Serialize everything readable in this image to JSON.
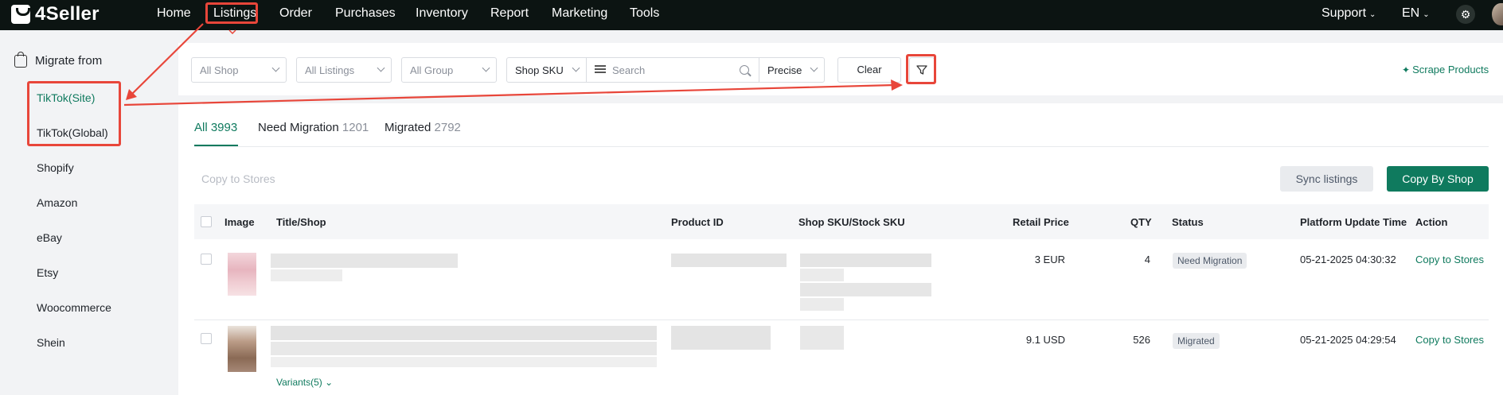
{
  "brand": {
    "name": "4Seller"
  },
  "nav": {
    "items": [
      "Home",
      "Listings",
      "Order",
      "Purchases",
      "Inventory",
      "Report",
      "Marketing",
      "Tools"
    ],
    "support": "Support",
    "language": "EN"
  },
  "sidebar": {
    "heading": "Migrate from",
    "items": [
      "TikTok(Site)",
      "TikTok(Global)",
      "Shopify",
      "Amazon",
      "eBay",
      "Etsy",
      "Woocommerce",
      "Shein"
    ]
  },
  "filters": {
    "shop": "All Shop",
    "listings": "All Listings",
    "group": "All Group",
    "sku_type": "Shop SKU",
    "search_placeholder": "Search",
    "match_mode": "Precise",
    "clear": "Clear",
    "scrape": "Scrape Products"
  },
  "tabs": [
    {
      "label": "All",
      "count": "3993"
    },
    {
      "label": "Need Migration",
      "count": "1201"
    },
    {
      "label": "Migrated",
      "count": "2792"
    }
  ],
  "actions": {
    "copy_to_stores": "Copy to Stores",
    "sync": "Sync listings",
    "copy_by_shop": "Copy By Shop"
  },
  "table": {
    "columns": [
      "Image",
      "Title/Shop",
      "Product ID",
      "Shop SKU/Stock SKU",
      "Retail Price",
      "QTY",
      "Status",
      "Platform Update Time",
      "Action"
    ],
    "rows": [
      {
        "price": "3 EUR",
        "qty": "4",
        "status": "Need Migration",
        "time": "05-21-2025 04:30:32",
        "action": "Copy to Stores"
      },
      {
        "price": "9.1 USD",
        "qty": "526",
        "status": "Migrated",
        "time": "05-21-2025 04:29:54",
        "action": "Copy to Stores",
        "variants": "Variants(5)"
      }
    ]
  },
  "colors": {
    "accent": "#0f7a5e",
    "annotation": "#e8463a",
    "nav_bg": "#0c1412"
  }
}
